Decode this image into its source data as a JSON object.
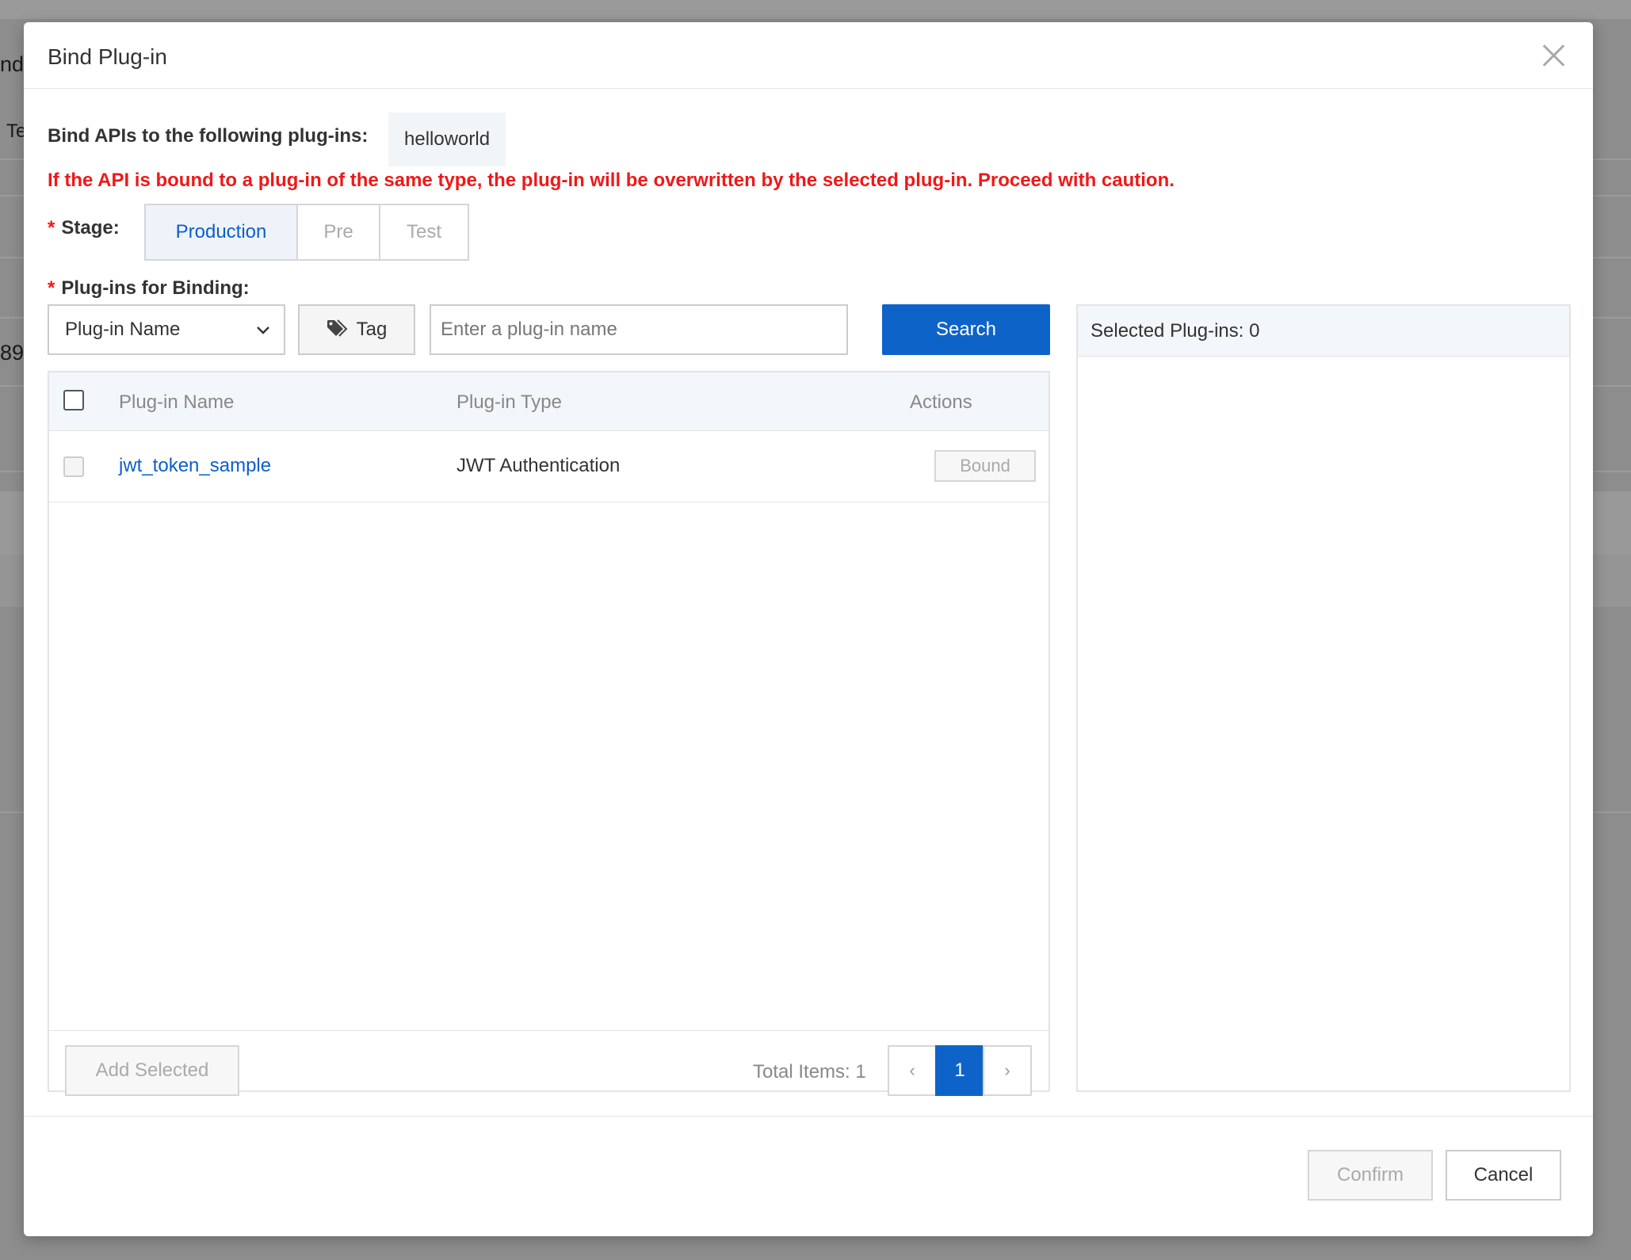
{
  "background": {
    "fragments": [
      "ndi",
      "Te",
      "89"
    ]
  },
  "dialog": {
    "title": "Bind Plug-in",
    "bind_label": "Bind APIs to the following plug-ins:",
    "api_name": "helloworld",
    "warning": "If the API is bound to a plug-in of the same type, the plug-in will be overwritten by the selected plug-in. Proceed with caution.",
    "stage_label": "Stage:",
    "required_mark": "*",
    "stages": [
      {
        "label": "Production",
        "active": true
      },
      {
        "label": "Pre",
        "active": false
      },
      {
        "label": "Test",
        "active": false
      }
    ],
    "plugins_label": "Plug-ins for Binding:",
    "filter_select": "Plug-in Name",
    "tag_button": "Tag",
    "search_placeholder": "Enter a plug-in name",
    "search_value": "",
    "search_button": "Search",
    "table": {
      "columns": [
        "Plug-in Name",
        "Plug-in Type",
        "Actions"
      ],
      "rows": [
        {
          "name": "jwt_token_sample",
          "type": "JWT Authentication",
          "action": "Bound"
        }
      ]
    },
    "add_selected": "Add Selected",
    "total_items": "Total Items: 1",
    "pager": {
      "prev": "‹",
      "current": "1",
      "next": "›"
    },
    "selected_header": "Selected Plug-ins: 0",
    "confirm": "Confirm",
    "cancel": "Cancel"
  },
  "colors": {
    "primary": "#0e63c9",
    "link": "#0d5ec9",
    "warning": "#f01818",
    "disabled_text": "#aaaaaa"
  }
}
